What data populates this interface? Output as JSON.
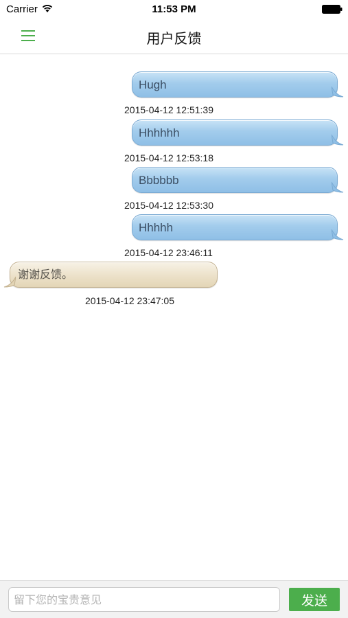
{
  "status_bar": {
    "carrier": "Carrier",
    "time": "11:53 PM",
    "wifi_icon": "wifi-icon",
    "battery_icon": "battery-icon"
  },
  "nav": {
    "title": "用户反馈",
    "menu_icon": "hamburger-menu-icon",
    "accent_color": "#4cae4c"
  },
  "messages": [
    {
      "direction": "outgoing",
      "text": "Hugh",
      "time": "2015-04-12 12:51:39"
    },
    {
      "direction": "outgoing",
      "text": "Hhhhhh",
      "time": "2015-04-12 12:53:18"
    },
    {
      "direction": "outgoing",
      "text": "Bbbbbb",
      "time": "2015-04-12 12:53:30"
    },
    {
      "direction": "outgoing",
      "text": "Hhhhh",
      "time": "2015-04-12 23:46:11"
    },
    {
      "direction": "incoming",
      "text": "谢谢反馈。",
      "time": "2015-04-12 23:47:05"
    }
  ],
  "input": {
    "placeholder": "留下您的宝贵意见",
    "value": "",
    "send_label": "发送"
  }
}
